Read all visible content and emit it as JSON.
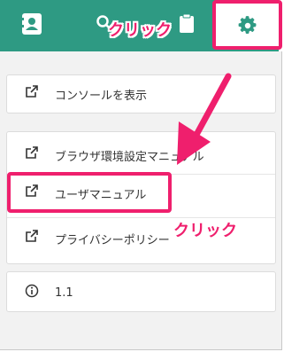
{
  "header": {
    "icons": [
      "contacts-icon",
      "search-icon",
      "clipboard-icon",
      "gear-icon"
    ]
  },
  "menu": {
    "console_label": "コンソールを表示",
    "manual_items": [
      {
        "label": "ブラウザ環境設定マニュアル",
        "icon": "external-link-icon"
      },
      {
        "label": "ユーザマニュアル",
        "icon": "external-link-icon"
      },
      {
        "label": "プライバシーポリシー",
        "icon": "external-link-icon"
      }
    ],
    "version": "1.1"
  },
  "annotations": {
    "click_top": "クリック",
    "click_bottom": "クリック",
    "accent_color": "#ef1f6d"
  },
  "colors": {
    "header": "#2e9a83",
    "panel": "#f2f2f2"
  }
}
